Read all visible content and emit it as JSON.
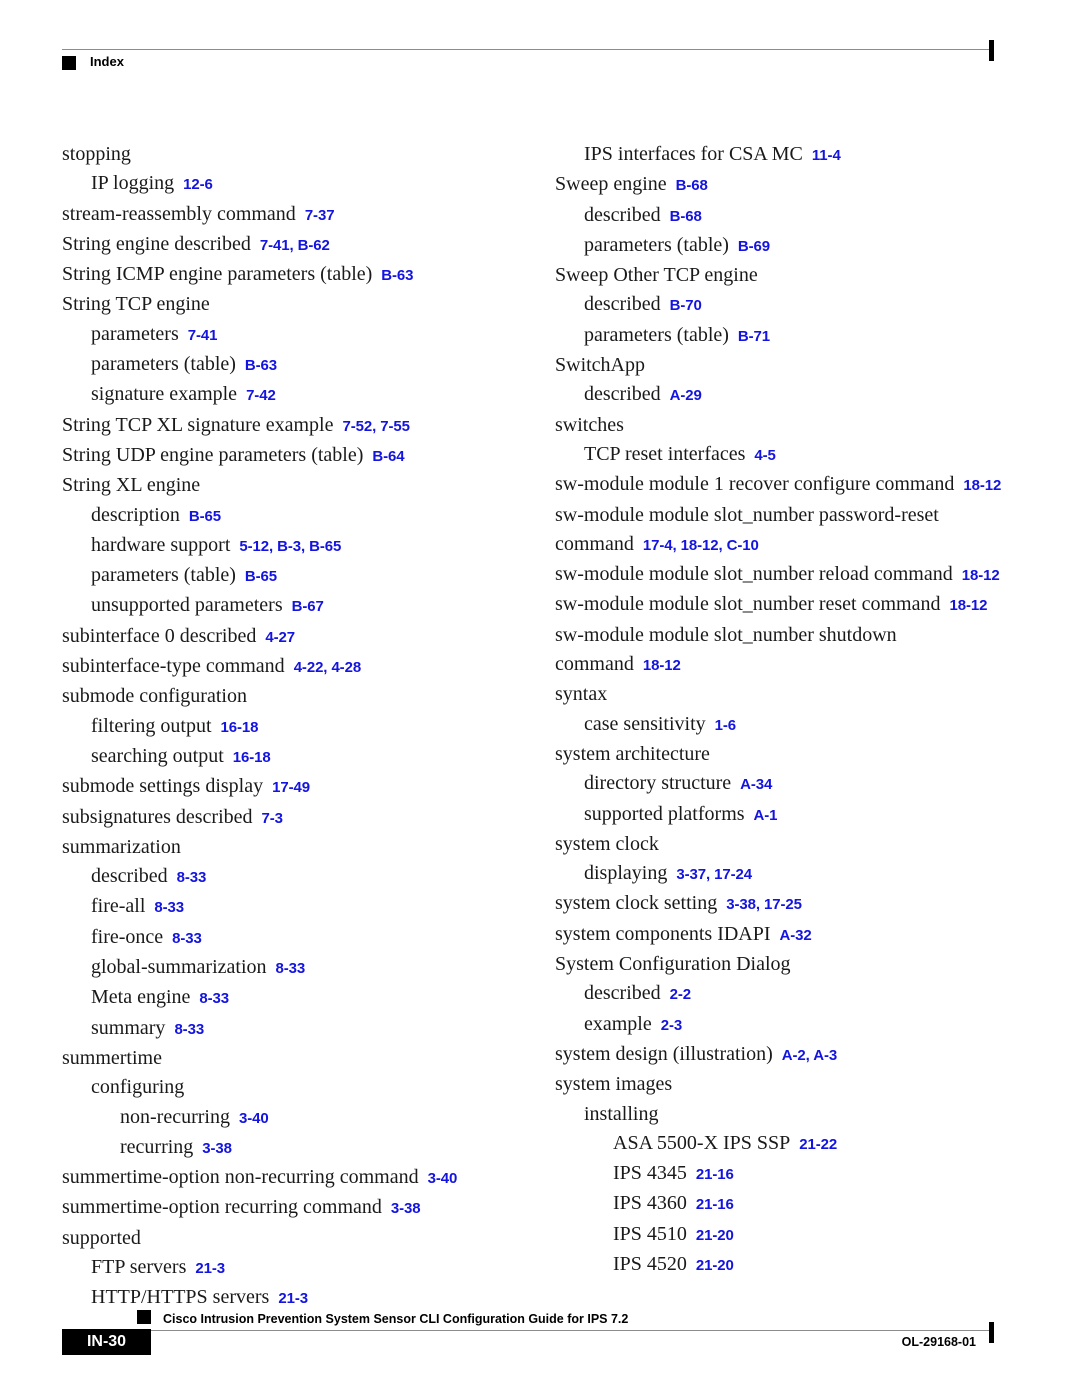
{
  "header": {
    "label": "Index",
    "square_icon": "black-square-icon"
  },
  "footer": {
    "doc_title": "Cisco Intrusion Prevention System Sensor CLI Configuration Guide for IPS 7.2",
    "page_number": "IN-30",
    "doc_id": "OL-29168-01",
    "square_icon": "black-square-icon"
  },
  "colors": {
    "reference_blue": "#1414e0",
    "text_black": "#1a1a1a",
    "rule_gray": "#8c8c8c",
    "footer_box_bg": "#000000",
    "footer_box_text": "#ffffff"
  },
  "index": {
    "left_column": [
      {
        "level": 0,
        "term": "stopping",
        "refs": ""
      },
      {
        "level": 1,
        "term": "IP logging",
        "refs": "12-6"
      },
      {
        "level": 0,
        "term": "stream-reassembly command",
        "refs": "7-37"
      },
      {
        "level": 0,
        "term": "String engine described",
        "refs": "7-41, B-62"
      },
      {
        "level": 0,
        "term": "String ICMP engine parameters (table)",
        "refs": "B-63"
      },
      {
        "level": 0,
        "term": "String TCP engine",
        "refs": ""
      },
      {
        "level": 1,
        "term": "parameters",
        "refs": "7-41"
      },
      {
        "level": 1,
        "term": "parameters (table)",
        "refs": "B-63"
      },
      {
        "level": 1,
        "term": "signature example",
        "refs": "7-42"
      },
      {
        "level": 0,
        "term": "String TCP XL signature example",
        "refs": "7-52, 7-55"
      },
      {
        "level": 0,
        "term": "String UDP engine parameters (table)",
        "refs": "B-64"
      },
      {
        "level": 0,
        "term": "String XL engine",
        "refs": ""
      },
      {
        "level": 1,
        "term": "description",
        "refs": "B-65"
      },
      {
        "level": 1,
        "term": "hardware support",
        "refs": "5-12, B-3, B-65"
      },
      {
        "level": 1,
        "term": "parameters (table)",
        "refs": "B-65"
      },
      {
        "level": 1,
        "term": "unsupported parameters",
        "refs": "B-67"
      },
      {
        "level": 0,
        "term": "subinterface 0 described",
        "refs": "4-27"
      },
      {
        "level": 0,
        "term": "subinterface-type command",
        "refs": "4-22, 4-28"
      },
      {
        "level": 0,
        "term": "submode configuration",
        "refs": ""
      },
      {
        "level": 1,
        "term": "filtering output",
        "refs": "16-18"
      },
      {
        "level": 1,
        "term": "searching output",
        "refs": "16-18"
      },
      {
        "level": 0,
        "term": "submode settings display",
        "refs": "17-49"
      },
      {
        "level": 0,
        "term": "subsignatures described",
        "refs": "7-3"
      },
      {
        "level": 0,
        "term": "summarization",
        "refs": ""
      },
      {
        "level": 1,
        "term": "described",
        "refs": "8-33"
      },
      {
        "level": 1,
        "term": "fire-all",
        "refs": "8-33"
      },
      {
        "level": 1,
        "term": "fire-once",
        "refs": "8-33"
      },
      {
        "level": 1,
        "term": "global-summarization",
        "refs": "8-33"
      },
      {
        "level": 1,
        "term": "Meta engine",
        "refs": "8-33"
      },
      {
        "level": 1,
        "term": "summary",
        "refs": "8-33"
      },
      {
        "level": 0,
        "term": "summertime",
        "refs": ""
      },
      {
        "level": 1,
        "term": "configuring",
        "refs": ""
      },
      {
        "level": 2,
        "term": "non-recurring",
        "refs": "3-40"
      },
      {
        "level": 2,
        "term": "recurring",
        "refs": "3-38"
      },
      {
        "level": 0,
        "term": "summertime-option non-recurring command",
        "refs": "3-40"
      },
      {
        "level": 0,
        "term": "summertime-option recurring command",
        "refs": "3-38"
      },
      {
        "level": 0,
        "term": "supported",
        "refs": ""
      },
      {
        "level": 1,
        "term": "FTP servers",
        "refs": "21-3"
      },
      {
        "level": 1,
        "term": "HTTP/HTTPS servers",
        "refs": "21-3"
      }
    ],
    "right_column": [
      {
        "level": 1,
        "term": "IPS interfaces for CSA MC",
        "refs": "11-4"
      },
      {
        "level": 0,
        "term": "Sweep engine",
        "refs": "B-68"
      },
      {
        "level": 1,
        "term": "described",
        "refs": "B-68"
      },
      {
        "level": 1,
        "term": "parameters (table)",
        "refs": "B-69"
      },
      {
        "level": 0,
        "term": "Sweep Other TCP engine",
        "refs": ""
      },
      {
        "level": 1,
        "term": "described",
        "refs": "B-70"
      },
      {
        "level": 1,
        "term": "parameters (table)",
        "refs": "B-71"
      },
      {
        "level": 0,
        "term": "SwitchApp",
        "refs": ""
      },
      {
        "level": 1,
        "term": "described",
        "refs": "A-29"
      },
      {
        "level": 0,
        "term": "switches",
        "refs": ""
      },
      {
        "level": 1,
        "term": "TCP reset interfaces",
        "refs": "4-5"
      },
      {
        "level": 0,
        "term": "sw-module module 1 recover configure command",
        "refs": "18-12"
      },
      {
        "level": 0,
        "term": "sw-module module slot_number password-reset command",
        "refs": "17-4, 18-12, C-10"
      },
      {
        "level": 0,
        "term": "sw-module module slot_number reload command",
        "refs": "18-12"
      },
      {
        "level": 0,
        "term": "sw-module module slot_number reset command",
        "refs": "18-12"
      },
      {
        "level": 0,
        "term": "sw-module module slot_number shutdown command",
        "refs": "18-12"
      },
      {
        "level": 0,
        "term": "syntax",
        "refs": ""
      },
      {
        "level": 1,
        "term": "case sensitivity",
        "refs": "1-6"
      },
      {
        "level": 0,
        "term": "system architecture",
        "refs": ""
      },
      {
        "level": 1,
        "term": "directory structure",
        "refs": "A-34"
      },
      {
        "level": 1,
        "term": "supported platforms",
        "refs": "A-1"
      },
      {
        "level": 0,
        "term": "system clock",
        "refs": ""
      },
      {
        "level": 1,
        "term": "displaying",
        "refs": "3-37, 17-24"
      },
      {
        "level": 0,
        "term": "system clock setting",
        "refs": "3-38, 17-25"
      },
      {
        "level": 0,
        "term": "system components IDAPI",
        "refs": "A-32"
      },
      {
        "level": 0,
        "term": "System Configuration Dialog",
        "refs": ""
      },
      {
        "level": 1,
        "term": "described",
        "refs": "2-2"
      },
      {
        "level": 1,
        "term": "example",
        "refs": "2-3"
      },
      {
        "level": 0,
        "term": "system design (illustration)",
        "refs": "A-2, A-3"
      },
      {
        "level": 0,
        "term": "system images",
        "refs": ""
      },
      {
        "level": 1,
        "term": "installing",
        "refs": ""
      },
      {
        "level": 2,
        "term": "ASA 5500-X IPS SSP",
        "refs": "21-22"
      },
      {
        "level": 2,
        "term": "IPS 4345",
        "refs": "21-16"
      },
      {
        "level": 2,
        "term": "IPS 4360",
        "refs": "21-16"
      },
      {
        "level": 2,
        "term": "IPS 4510",
        "refs": "21-20"
      },
      {
        "level": 2,
        "term": "IPS 4520",
        "refs": "21-20"
      }
    ]
  }
}
